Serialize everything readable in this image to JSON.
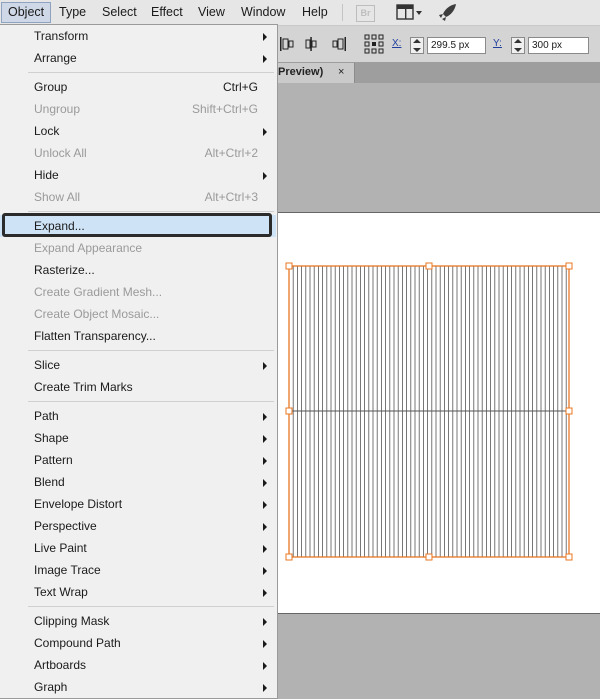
{
  "menubar": {
    "items": [
      "Object",
      "Type",
      "Select",
      "Effect",
      "View",
      "Window",
      "Help"
    ],
    "active": "Object",
    "bridge_label": "Br",
    "icons": [
      "bridge-icon",
      "workspace-switcher-icon",
      "rocket-icon"
    ]
  },
  "control_bar": {
    "x_label": "X:",
    "x_value": "299.5 px",
    "y_label": "Y:",
    "y_value": "300 px"
  },
  "document_tab": {
    "label": "Preview)",
    "close": "×"
  },
  "object_menu": {
    "items": [
      {
        "label": "Transform",
        "shortcut": "",
        "submenu": true,
        "disabled": false
      },
      {
        "label": "Arrange",
        "shortcut": "",
        "submenu": true,
        "disabled": false
      },
      {
        "label": "Group",
        "shortcut": "Ctrl+G",
        "submenu": false,
        "disabled": false
      },
      {
        "label": "Ungroup",
        "shortcut": "Shift+Ctrl+G",
        "submenu": false,
        "disabled": true
      },
      {
        "label": "Lock",
        "shortcut": "",
        "submenu": true,
        "disabled": false
      },
      {
        "label": "Unlock All",
        "shortcut": "Alt+Ctrl+2",
        "submenu": false,
        "disabled": true
      },
      {
        "label": "Hide",
        "shortcut": "",
        "submenu": true,
        "disabled": false
      },
      {
        "label": "Show All",
        "shortcut": "Alt+Ctrl+3",
        "submenu": false,
        "disabled": true
      },
      {
        "label": "Expand...",
        "shortcut": "",
        "submenu": false,
        "disabled": false,
        "highlighted": true
      },
      {
        "label": "Expand Appearance",
        "shortcut": "",
        "submenu": false,
        "disabled": true
      },
      {
        "label": "Rasterize...",
        "shortcut": "",
        "submenu": false,
        "disabled": false
      },
      {
        "label": "Create Gradient Mesh...",
        "shortcut": "",
        "submenu": false,
        "disabled": true
      },
      {
        "label": "Create Object Mosaic...",
        "shortcut": "",
        "submenu": false,
        "disabled": true
      },
      {
        "label": "Flatten Transparency...",
        "shortcut": "",
        "submenu": false,
        "disabled": false
      },
      {
        "label": "Slice",
        "shortcut": "",
        "submenu": true,
        "disabled": false
      },
      {
        "label": "Create Trim Marks",
        "shortcut": "",
        "submenu": false,
        "disabled": false
      },
      {
        "label": "Path",
        "shortcut": "",
        "submenu": true,
        "disabled": false
      },
      {
        "label": "Shape",
        "shortcut": "",
        "submenu": true,
        "disabled": false
      },
      {
        "label": "Pattern",
        "shortcut": "",
        "submenu": true,
        "disabled": false
      },
      {
        "label": "Blend",
        "shortcut": "",
        "submenu": true,
        "disabled": false
      },
      {
        "label": "Envelope Distort",
        "shortcut": "",
        "submenu": true,
        "disabled": false
      },
      {
        "label": "Perspective",
        "shortcut": "",
        "submenu": true,
        "disabled": false
      },
      {
        "label": "Live Paint",
        "shortcut": "",
        "submenu": true,
        "disabled": false
      },
      {
        "label": "Image Trace",
        "shortcut": "",
        "submenu": true,
        "disabled": false
      },
      {
        "label": "Text Wrap",
        "shortcut": "",
        "submenu": true,
        "disabled": false
      },
      {
        "label": "Clipping Mask",
        "shortcut": "",
        "submenu": true,
        "disabled": false
      },
      {
        "label": "Compound Path",
        "shortcut": "",
        "submenu": true,
        "disabled": false
      },
      {
        "label": "Artboards",
        "shortcut": "",
        "submenu": true,
        "disabled": false
      },
      {
        "label": "Graph",
        "shortcut": "",
        "submenu": true,
        "disabled": false
      }
    ]
  },
  "artwork": {
    "stroke_color": "#e87722",
    "line_color": "#555555",
    "selection_color": "#e87722"
  }
}
